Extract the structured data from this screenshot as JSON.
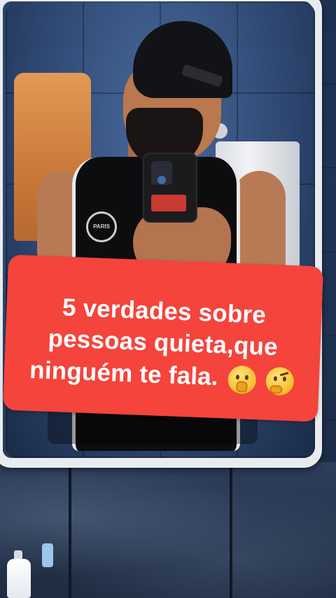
{
  "caption": {
    "line1": "5 verdades sobre",
    "line2": "pessoas quieta,que",
    "line3": "ninguém te fala.",
    "emojis": [
      "shushing-face-emoji",
      "thinking-face-emoji"
    ],
    "background_color": "#f4443c",
    "text_color": "#ffffff"
  },
  "jersey": {
    "crest_text": "PARIS"
  }
}
